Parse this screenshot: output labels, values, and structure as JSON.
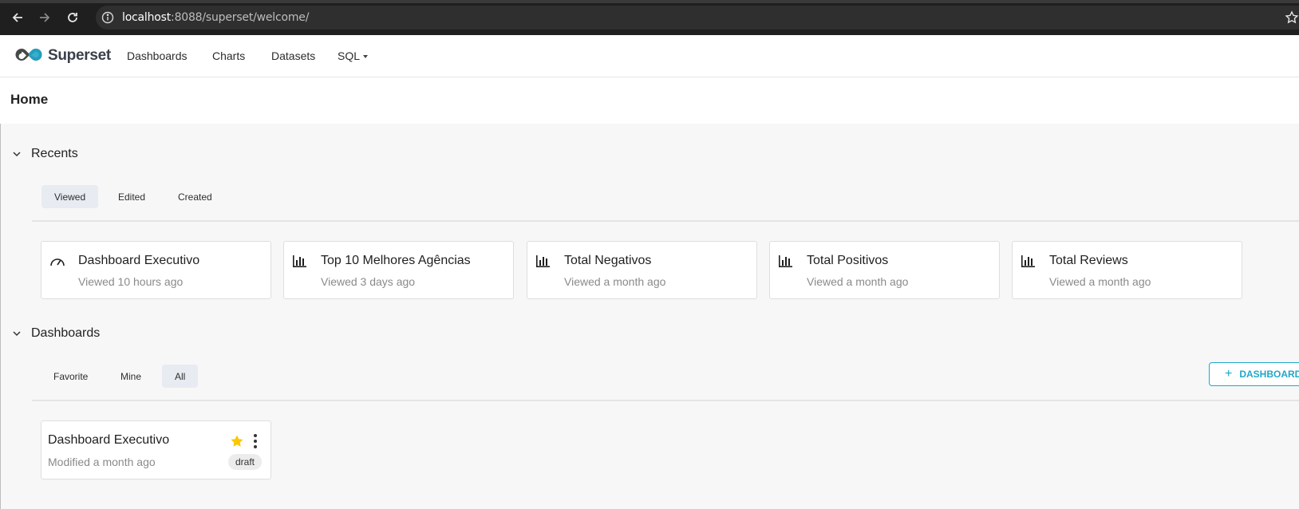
{
  "browser": {
    "url_host": "localhost",
    "url_rest": ":8088/superset/welcome/"
  },
  "header": {
    "brand": "Superset",
    "menu": [
      "Dashboards",
      "Charts",
      "Datasets",
      "SQL"
    ]
  },
  "page": {
    "title": "Home"
  },
  "recents": {
    "title": "Recents",
    "tabs": [
      "Viewed",
      "Edited",
      "Created"
    ],
    "active_tab": "Viewed",
    "cards": [
      {
        "icon": "dashboard-gauge-icon",
        "title": "Dashboard Executivo",
        "subtitle": "Viewed 10 hours ago"
      },
      {
        "icon": "bar-chart-icon",
        "title": "Top 10 Melhores Agências",
        "subtitle": "Viewed 3 days ago"
      },
      {
        "icon": "bar-chart-icon",
        "title": "Total Negativos",
        "subtitle": "Viewed a month ago"
      },
      {
        "icon": "bar-chart-icon",
        "title": "Total Positivos",
        "subtitle": "Viewed a month ago"
      },
      {
        "icon": "bar-chart-icon",
        "title": "Total Reviews",
        "subtitle": "Viewed a month ago"
      }
    ]
  },
  "dashboards": {
    "title": "Dashboards",
    "tabs": [
      "Favorite",
      "Mine",
      "All"
    ],
    "active_tab": "All",
    "add_button": "DASHBOARD",
    "items": [
      {
        "title": "Dashboard Executivo",
        "subtitle": "Modified a month ago",
        "badge": "draft",
        "favorite": true
      }
    ]
  },
  "colors": {
    "accent": "#20a7c9",
    "favorite_star": "#fcc700",
    "active_tab_bg": "#e8ebf1"
  }
}
